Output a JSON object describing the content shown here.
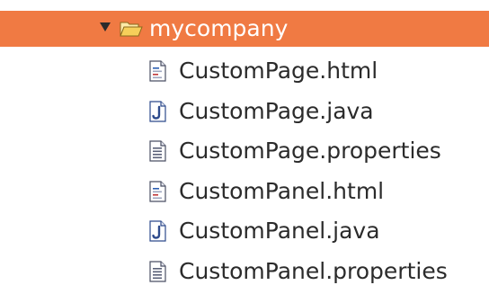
{
  "tree": {
    "folder": {
      "label": "mycompany",
      "expanded": true,
      "icon": "open-folder-icon",
      "highlight_color": "#f07a43"
    },
    "files": [
      {
        "label": "CustomPage.html",
        "icon": "html-file-icon"
      },
      {
        "label": "CustomPage.java",
        "icon": "java-file-icon"
      },
      {
        "label": "CustomPage.properties",
        "icon": "properties-file-icon"
      },
      {
        "label": "CustomPanel.html",
        "icon": "html-file-icon"
      },
      {
        "label": "CustomPanel.java",
        "icon": "java-file-icon"
      },
      {
        "label": "CustomPanel.properties",
        "icon": "properties-file-icon"
      }
    ]
  }
}
